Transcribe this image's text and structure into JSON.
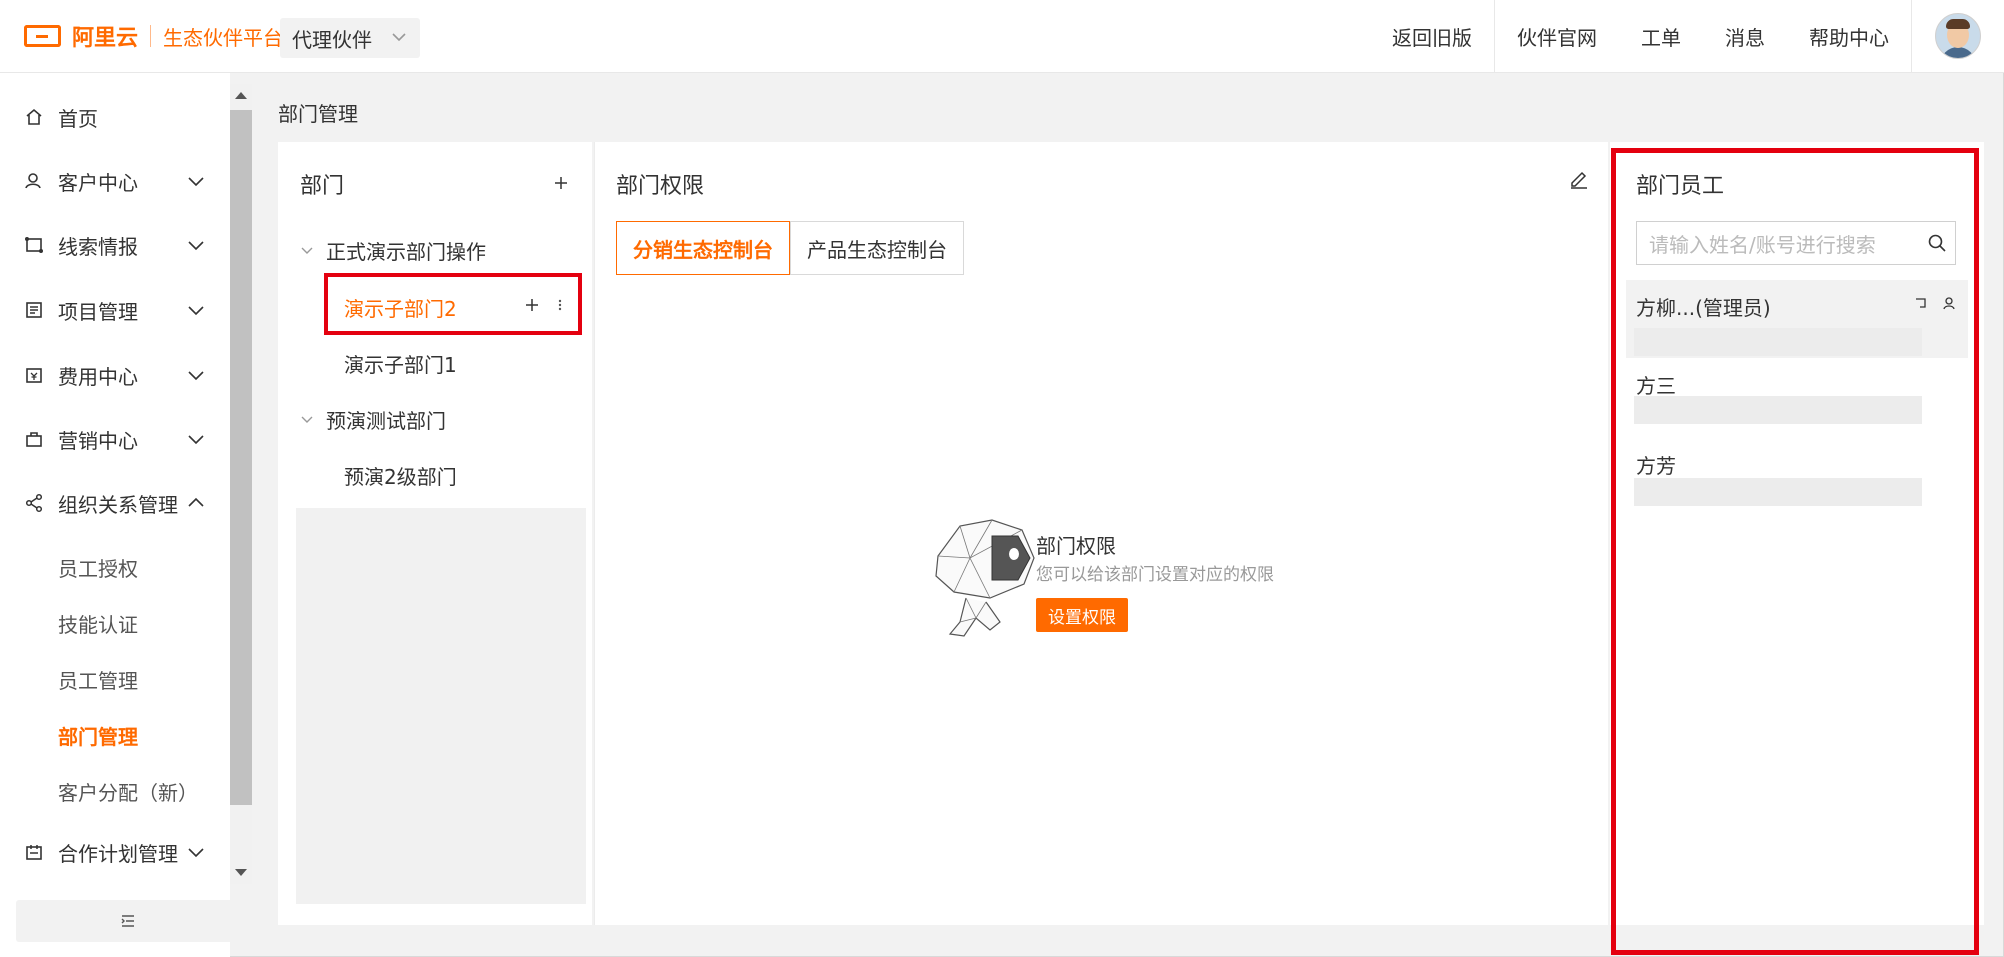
{
  "topbar": {
    "brand": "阿里云",
    "platform": "生态伙伴平台",
    "role_select": "代理伙伴",
    "nav": [
      "返回旧版",
      "伙伴官网",
      "工单",
      "消息",
      "帮助中心"
    ]
  },
  "sidebar": {
    "items": [
      {
        "label": "首页",
        "icon": "home-icon"
      },
      {
        "label": "客户中心",
        "icon": "user-icon"
      },
      {
        "label": "线索情报",
        "icon": "clue-icon"
      },
      {
        "label": "项目管理",
        "icon": "project-icon"
      },
      {
        "label": "费用中心",
        "icon": "fee-icon"
      },
      {
        "label": "营销中心",
        "icon": "bag-icon"
      },
      {
        "label": "组织关系管理",
        "icon": "share-icon"
      },
      {
        "label": "合作计划管理",
        "icon": "calendar-icon"
      }
    ],
    "sub_items": [
      "员工授权",
      "技能认证",
      "员工管理",
      "部门管理",
      "客户分配（新）"
    ],
    "active_sub": "部门管理"
  },
  "breadcrumb": "部门管理",
  "dept_panel": {
    "title": "部门",
    "tree": [
      {
        "label": "正式演示部门操作",
        "level": 0
      },
      {
        "label": "演示子部门2",
        "level": 1,
        "active": true
      },
      {
        "label": "演示子部门1",
        "level": 1
      },
      {
        "label": "预演测试部门",
        "level": 0
      },
      {
        "label": "预演2级部门",
        "level": 1
      }
    ]
  },
  "perm_panel": {
    "title": "部门权限",
    "tabs": [
      "分销生态控制台",
      "产品生态控制台"
    ],
    "empty_title": "部门权限",
    "empty_desc": "您可以给该部门设置对应的权限",
    "empty_button": "设置权限"
  },
  "staff_panel": {
    "title": "部门员工",
    "search_placeholder": "请输入姓名/账号进行搜索",
    "staff": [
      "方柳...(管理员)",
      "方三",
      "方芳"
    ]
  }
}
